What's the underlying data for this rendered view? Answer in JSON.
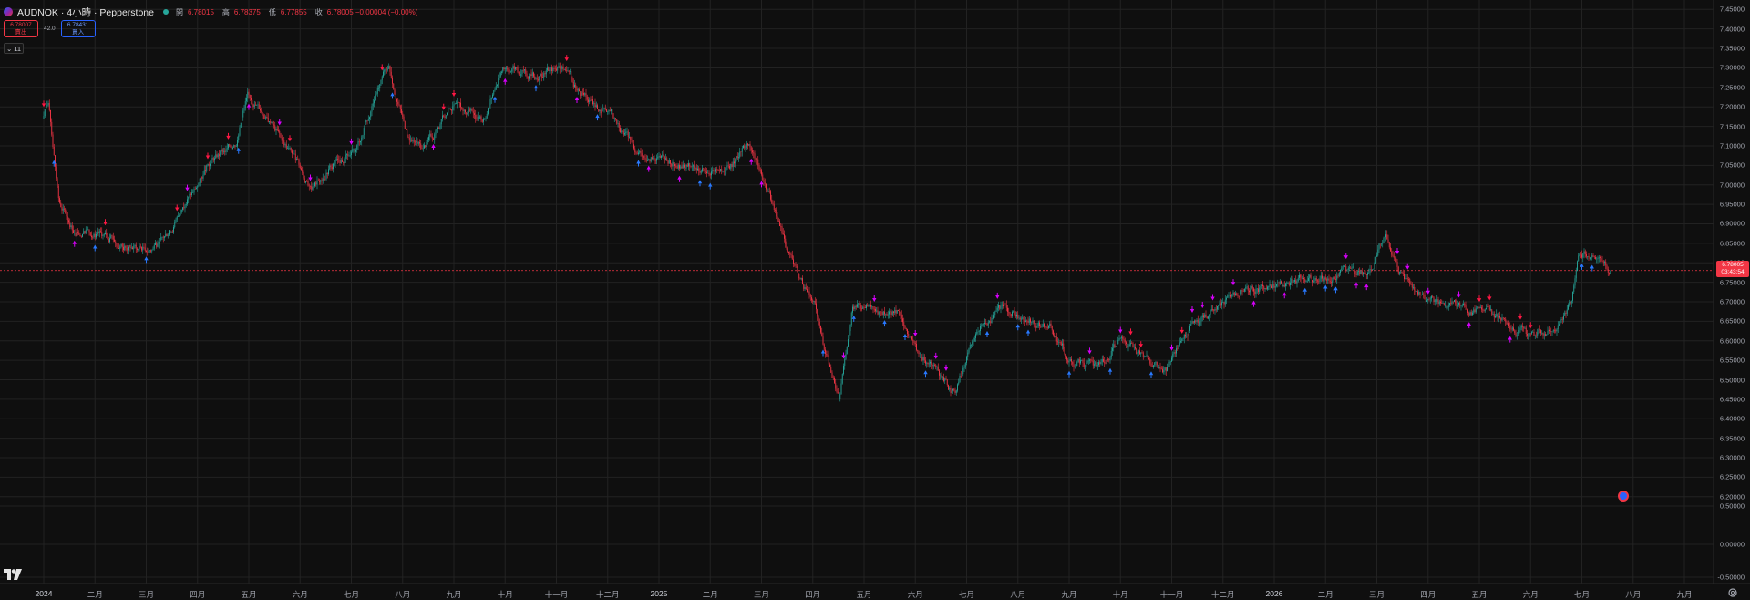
{
  "header": {
    "title": "AUDNOK · 4小時 · Pepperstone",
    "ohlc": [
      {
        "label": "開",
        "value": "6.78015"
      },
      {
        "label": "高",
        "value": "6.78375"
      },
      {
        "label": "低",
        "value": "6.77855"
      },
      {
        "label": "收",
        "value": "6.78005 −0.00004 (−0.00%)"
      }
    ]
  },
  "trade": {
    "sell_price": "6.78007",
    "sell_label": "賣出",
    "spread": "42.0",
    "buy_price": "6.78431",
    "buy_label": "買入"
  },
  "indicator_toggle": "11",
  "last_price_tag": {
    "price": "6.78005",
    "countdown": "03:43:54"
  },
  "colors": {
    "up": "#26a69a",
    "down": "#f23645",
    "signal_buy": "#2979ff",
    "signal_sell": "#ff1744",
    "signal_other": "#d500f9",
    "price_line": "#f23645"
  },
  "icons": {
    "logo": "tradingview-logo",
    "settings": "gear-icon",
    "event": "event-flag-icon",
    "collapse": "chevron-down-icon"
  },
  "chart_data": {
    "type": "candlestick",
    "symbol": "AUDNOK",
    "interval": "4h",
    "y_axis_ticks": [
      "7.45000",
      "7.40000",
      "7.35000",
      "7.30000",
      "7.25000",
      "7.20000",
      "7.15000",
      "7.10000",
      "7.05000",
      "7.00000",
      "6.95000",
      "6.90000",
      "6.85000",
      "6.80000",
      "6.75000",
      "6.70000",
      "6.65000",
      "6.60000",
      "6.55000",
      "6.50000",
      "6.45000",
      "6.40000",
      "6.35000",
      "6.30000",
      "6.25000",
      "6.20000",
      "0.50000",
      "0.00000",
      "-0.50000"
    ],
    "x_axis_ticks": [
      "2024",
      "二月",
      "三月",
      "四月",
      "五月",
      "六月",
      "七月",
      "八月",
      "九月",
      "十月",
      "十一月",
      "十二月",
      "2025",
      "二月",
      "三月",
      "四月",
      "五月",
      "六月",
      "七月",
      "八月",
      "九月",
      "十月",
      "十一月",
      "十二月",
      "2026",
      "二月",
      "三月",
      "四月",
      "五月",
      "六月",
      "七月",
      "八月",
      "九月"
    ],
    "price_path": [
      {
        "x": "2024-01-01",
        "y": 7.17
      },
      {
        "x": "2024-01-04",
        "y": 7.22
      },
      {
        "x": "2024-01-10",
        "y": 6.96
      },
      {
        "x": "2024-01-20",
        "y": 6.88
      },
      {
        "x": "2024-02-05",
        "y": 6.87
      },
      {
        "x": "2024-02-20",
        "y": 6.84
      },
      {
        "x": "2024-03-10",
        "y": 6.84
      },
      {
        "x": "2024-03-25",
        "y": 6.94
      },
      {
        "x": "2024-04-10",
        "y": 7.06
      },
      {
        "x": "2024-04-25",
        "y": 7.11
      },
      {
        "x": "2024-05-02",
        "y": 7.24
      },
      {
        "x": "2024-05-15",
        "y": 7.16
      },
      {
        "x": "2024-05-30",
        "y": 7.07
      },
      {
        "x": "2024-06-08",
        "y": 6.98
      },
      {
        "x": "2024-06-20",
        "y": 7.05
      },
      {
        "x": "2024-07-05",
        "y": 7.08
      },
      {
        "x": "2024-07-18",
        "y": 7.24
      },
      {
        "x": "2024-07-25",
        "y": 7.31
      },
      {
        "x": "2024-08-05",
        "y": 7.13
      },
      {
        "x": "2024-08-15",
        "y": 7.09
      },
      {
        "x": "2024-09-01",
        "y": 7.2
      },
      {
        "x": "2024-09-20",
        "y": 7.17
      },
      {
        "x": "2024-10-01",
        "y": 7.31
      },
      {
        "x": "2024-10-20",
        "y": 7.28
      },
      {
        "x": "2024-11-05",
        "y": 7.3
      },
      {
        "x": "2024-11-20",
        "y": 7.22
      },
      {
        "x": "2024-12-05",
        "y": 7.18
      },
      {
        "x": "2024-12-20",
        "y": 7.09
      },
      {
        "x": "2025-01-10",
        "y": 7.06
      },
      {
        "x": "2025-01-25",
        "y": 7.04
      },
      {
        "x": "2025-02-15",
        "y": 7.05
      },
      {
        "x": "2025-02-25",
        "y": 7.11
      },
      {
        "x": "2025-03-05",
        "y": 7.03
      },
      {
        "x": "2025-03-15",
        "y": 6.9
      },
      {
        "x": "2025-03-28",
        "y": 6.76
      },
      {
        "x": "2025-04-05",
        "y": 6.69
      },
      {
        "x": "2025-04-15",
        "y": 6.52
      },
      {
        "x": "2025-04-20",
        "y": 6.45
      },
      {
        "x": "2025-04-28",
        "y": 6.7
      },
      {
        "x": "2025-05-10",
        "y": 6.67
      },
      {
        "x": "2025-05-25",
        "y": 6.68
      },
      {
        "x": "2025-06-05",
        "y": 6.58
      },
      {
        "x": "2025-06-20",
        "y": 6.51
      },
      {
        "x": "2025-06-28",
        "y": 6.46
      },
      {
        "x": "2025-07-10",
        "y": 6.62
      },
      {
        "x": "2025-07-25",
        "y": 6.68
      },
      {
        "x": "2025-08-10",
        "y": 6.66
      },
      {
        "x": "2025-08-25",
        "y": 6.63
      },
      {
        "x": "2025-09-05",
        "y": 6.55
      },
      {
        "x": "2025-09-20",
        "y": 6.53
      },
      {
        "x": "2025-10-05",
        "y": 6.6
      },
      {
        "x": "2025-10-20",
        "y": 6.55
      },
      {
        "x": "2025-11-01",
        "y": 6.52
      },
      {
        "x": "2025-11-15",
        "y": 6.63
      },
      {
        "x": "2025-12-01",
        "y": 6.68
      },
      {
        "x": "2025-12-15",
        "y": 6.73
      },
      {
        "x": "2026-01-05",
        "y": 6.74
      },
      {
        "x": "2026-01-25",
        "y": 6.76
      },
      {
        "x": "2026-02-15",
        "y": 6.77
      },
      {
        "x": "2026-03-05",
        "y": 6.79
      },
      {
        "x": "2026-03-12",
        "y": 6.88
      },
      {
        "x": "2026-03-20",
        "y": 6.77
      },
      {
        "x": "2026-04-05",
        "y": 6.7
      },
      {
        "x": "2026-04-20",
        "y": 6.69
      },
      {
        "x": "2026-05-05",
        "y": 6.68
      },
      {
        "x": "2026-05-20",
        "y": 6.66
      },
      {
        "x": "2026-06-05",
        "y": 6.61
      },
      {
        "x": "2026-06-20",
        "y": 6.63
      },
      {
        "x": "2026-07-01",
        "y": 6.69
      },
      {
        "x": "2026-07-05",
        "y": 6.82
      },
      {
        "x": "2026-07-15",
        "y": 6.83
      },
      {
        "x": "2026-07-25",
        "y": 6.78
      }
    ],
    "last_price": 6.78005,
    "ylim": [
      6.28,
      7.45
    ],
    "grid": true
  }
}
